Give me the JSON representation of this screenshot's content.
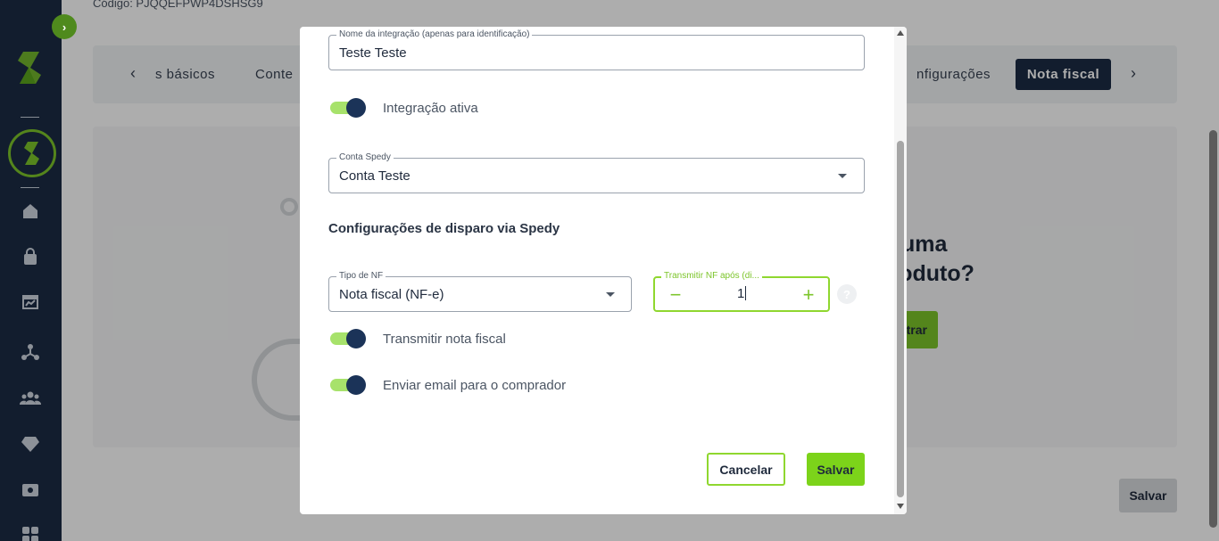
{
  "background": {
    "code_label": "Código: PJQQEFPWP4DSHSG9",
    "tabs": {
      "partial_basic": "s básicos",
      "partial_content": "Conte",
      "partial_config": "nfigurações",
      "active": "Nota fiscal"
    },
    "heading_line1": "izar uma",
    "heading_line2": "o produto?",
    "green_button_label": "trar",
    "save_button": "Salvar"
  },
  "sidebar": {
    "icons": [
      "logo-icon",
      "dashboard-ring-icon",
      "home-icon",
      "bag-icon",
      "presentation-icon",
      "network-icon",
      "users-icon",
      "diamond-icon",
      "ticket-icon",
      "apps-icon"
    ]
  },
  "modal": {
    "integration_name": {
      "label": "Nome da integração (apenas para identificação)",
      "value": "Teste Teste"
    },
    "integration_active": {
      "label": "Integração ativa",
      "checked": true
    },
    "spedy_account": {
      "label": "Conta Spedy",
      "value": "Conta Teste"
    },
    "section_title": "Configurações de disparo via Spedy",
    "nf_type": {
      "label": "Tipo de NF",
      "value": "Nota fiscal (NF-e)"
    },
    "transmit_after": {
      "label": "Transmitir NF após (di...",
      "value": "1",
      "minus": "−",
      "plus": "+"
    },
    "help": "?",
    "transmit_invoice": {
      "label": "Transmitir nota fiscal",
      "checked": true
    },
    "send_email": {
      "label": "Enviar email para o comprador",
      "checked": true
    },
    "cancel_button": "Cancelar",
    "save_button": "Salvar"
  },
  "colors": {
    "sidebar": "#1b2b45",
    "accent_green": "#7cc52a",
    "toggle_track": "#a7e26b",
    "toggle_knob": "#1b3358",
    "primary_dark": "#1b2b45"
  }
}
